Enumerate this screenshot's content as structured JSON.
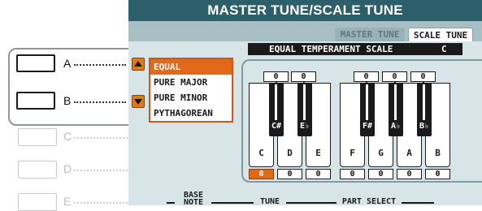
{
  "window": {
    "title": "MASTER TUNE/SCALE TUNE"
  },
  "tabs": [
    {
      "label": "MASTER TUNE",
      "active": false
    },
    {
      "label": "SCALE TUNE",
      "active": true
    }
  ],
  "scale_header": {
    "label": "EQUAL TEMPERAMENT SCALE",
    "key": "C"
  },
  "scale_list": {
    "items": [
      "EQUAL",
      "PURE MAJOR",
      "PURE MINOR",
      "PYTHAGOREAN"
    ],
    "selected": "EQUAL"
  },
  "panel_buttons": [
    {
      "letter": "A",
      "active": true
    },
    {
      "letter": "B",
      "active": true
    },
    {
      "letter": "C",
      "active": false
    },
    {
      "letter": "D",
      "active": false
    },
    {
      "letter": "E",
      "active": false
    }
  ],
  "keyboard": {
    "white_keys": [
      {
        "note": "C",
        "tune": "0"
      },
      {
        "note": "D",
        "tune": "0"
      },
      {
        "note": "E",
        "tune": "0"
      },
      {
        "note": "F",
        "tune": "0"
      },
      {
        "note": "G",
        "tune": "0"
      },
      {
        "note": "A",
        "tune": "0"
      },
      {
        "note": "B",
        "tune": "0"
      }
    ],
    "black_keys": [
      {
        "note": "C#",
        "tune": "0"
      },
      {
        "note": "E♭",
        "tune": "0"
      },
      {
        "note": "F#",
        "tune": "0"
      },
      {
        "note": "A♭",
        "tune": "0"
      },
      {
        "note": "B♭",
        "tune": "0"
      }
    ],
    "selected_note": "C"
  },
  "bottom_labels": {
    "base_note_line1": "BASE",
    "base_note_line2": "NOTE",
    "tune": "TUNE",
    "part_select": "PART SELECT"
  },
  "colors": {
    "title_bar": "#2d5f6a",
    "highlight": "#e06a1a",
    "screen_bg": "#d8e5e8"
  }
}
